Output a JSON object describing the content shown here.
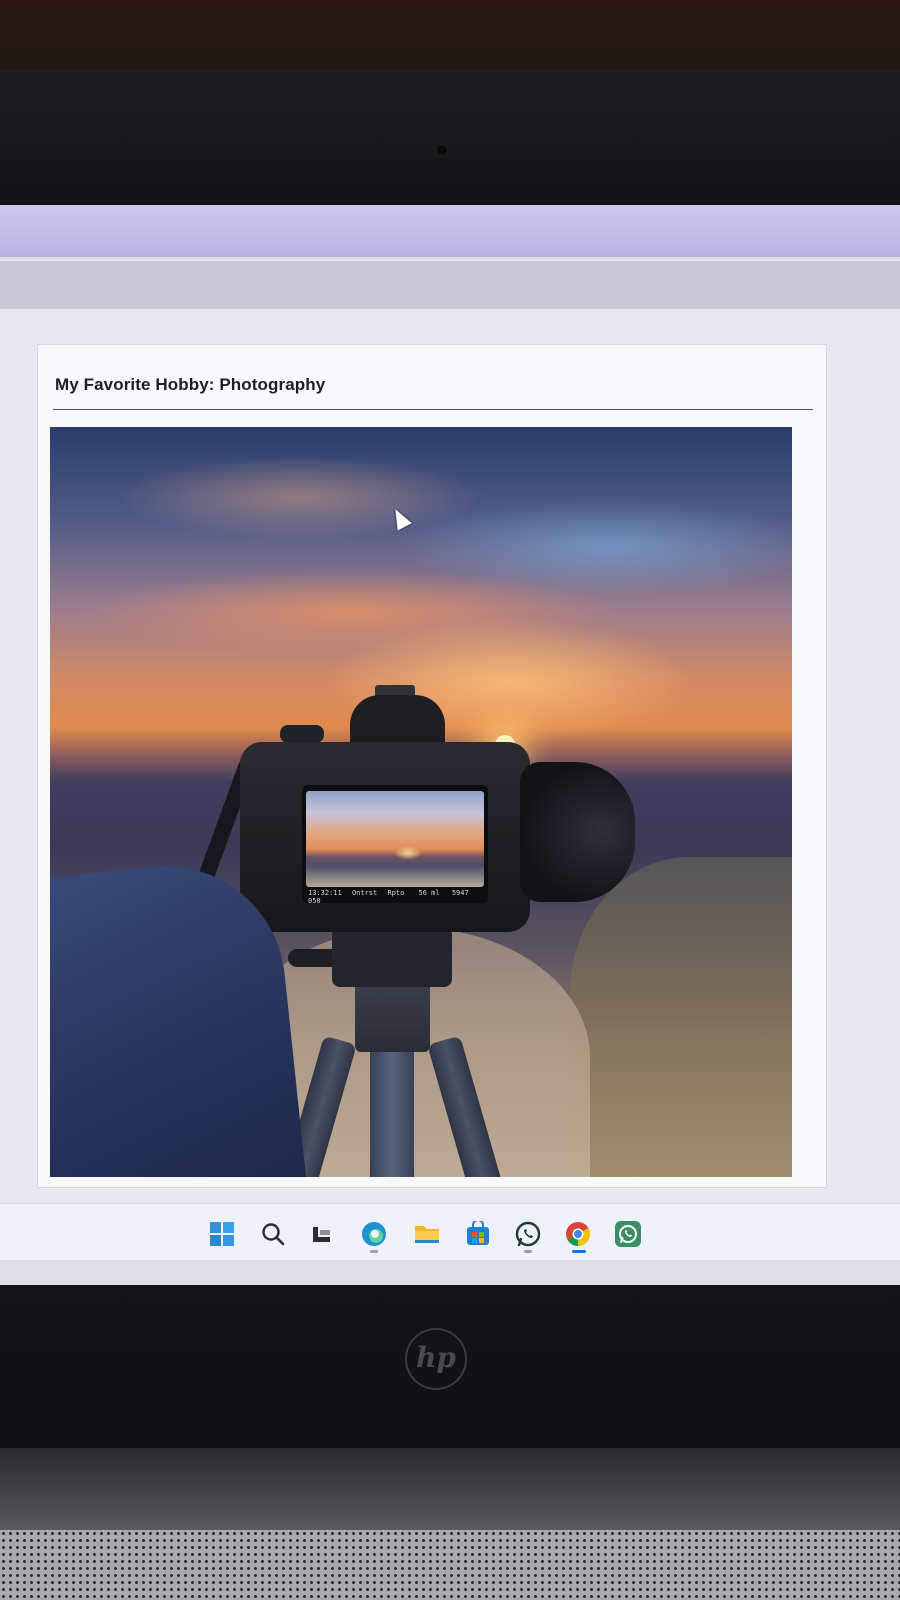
{
  "page": {
    "title": "My Favorite Hobby: Photography"
  },
  "photo": {
    "alt": "Photograph of a camera on a tripod facing a sunset over hills",
    "lcd": {
      "time": "13:32:11",
      "left_label": "Ontrst",
      "mode": "Rpto",
      "mid": "56 ml",
      "right": "5947 050"
    }
  },
  "taskbar": {
    "items": [
      {
        "name": "start",
        "icon": "windows-icon"
      },
      {
        "name": "search",
        "icon": "search-icon"
      },
      {
        "name": "task-view",
        "icon": "task-view-icon"
      },
      {
        "name": "edge",
        "icon": "edge-icon"
      },
      {
        "name": "file-explorer",
        "icon": "folder-icon"
      },
      {
        "name": "store",
        "icon": "store-icon"
      },
      {
        "name": "whatsapp",
        "icon": "whatsapp-icon"
      },
      {
        "name": "chrome",
        "icon": "chrome-icon"
      },
      {
        "name": "whatsapp-business",
        "icon": "whatsapp-business-icon"
      }
    ]
  },
  "device": {
    "logo": "hp"
  },
  "colors": {
    "accent_taskbar_active": "#1a73e8",
    "title_text": "#1b1f2b",
    "browser_chrome": "#c9c4ec"
  }
}
